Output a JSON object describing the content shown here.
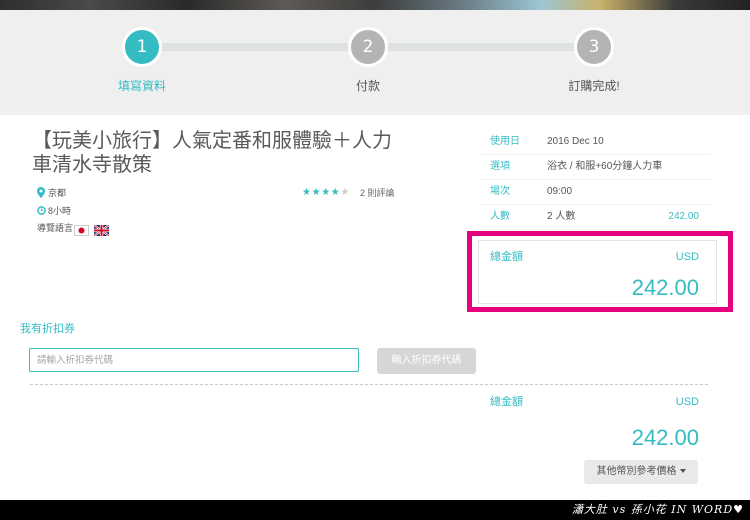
{
  "steps": [
    {
      "number": "1",
      "label": "填寫資料",
      "active": true
    },
    {
      "number": "2",
      "label": "付款",
      "active": false
    },
    {
      "number": "3",
      "label": "訂購完成!",
      "active": false
    }
  ],
  "product": {
    "title": "【玩美小旅行】人氣定番和服體驗＋人力車清水寺散策",
    "location": "京都",
    "duration": "8小時",
    "language_label": "導覽語言",
    "languages": [
      "japan-flag-icon",
      "uk-flag-icon"
    ],
    "rating": 4,
    "rating_max": 5,
    "reviews": "2 則評論"
  },
  "booking": {
    "rows": [
      {
        "label": "使用日",
        "value": "2016 Dec 10"
      },
      {
        "label": "選項",
        "value": "浴衣 / 和服+60分鐘人力車"
      },
      {
        "label": "場次",
        "value": "09:00"
      },
      {
        "label": "人數",
        "value": "2 人數",
        "amount": "242.00"
      }
    ],
    "total": {
      "label": "總金額",
      "currency": "USD",
      "amount": "242.00"
    }
  },
  "coupon": {
    "heading": "我有折扣券",
    "placeholder": "請輸入折扣券代碼",
    "button_label": "輸入折扣券代碼"
  },
  "summary": {
    "label": "總金額",
    "currency": "USD",
    "amount": "242.00",
    "other_currency_button": "其他幣別參考價格"
  },
  "watermark": "瀟大肚 vs 孫小花 IN WORD♥",
  "icons": {
    "location": "map-pin-icon",
    "duration": "clock-icon",
    "rating": "star-icon",
    "dropdown": "caret-down-icon"
  },
  "colors": {
    "accent": "#35bcc3",
    "highlight": "#e5007e",
    "inactive_step": "#b4b4b4"
  }
}
